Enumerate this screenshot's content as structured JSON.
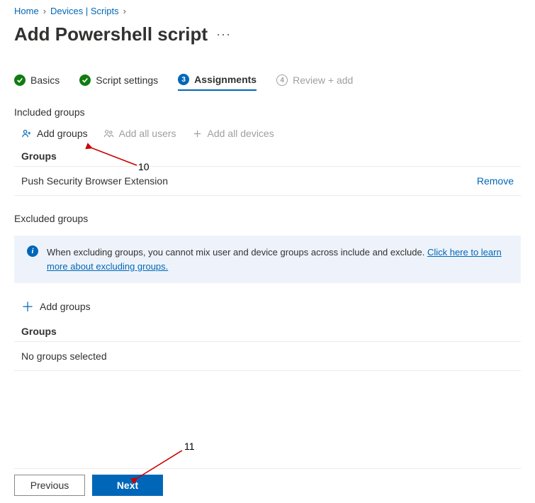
{
  "breadcrumb": {
    "items": [
      "Home",
      "Devices | Scripts"
    ]
  },
  "page_title": "Add Powershell script",
  "tabs": {
    "basics": "Basics",
    "script_settings": "Script settings",
    "assignments_num": "3",
    "assignments": "Assignments",
    "review_num": "4",
    "review": "Review + add"
  },
  "included": {
    "heading": "Included groups",
    "add_groups": "Add groups",
    "add_all_users": "Add all users",
    "add_all_devices": "Add all devices",
    "groups_label": "Groups",
    "rows": [
      {
        "name": "Push Security Browser Extension",
        "remove": "Remove"
      }
    ]
  },
  "excluded": {
    "heading": "Excluded groups",
    "info_text": "When excluding groups, you cannot mix user and device groups across include and exclude. ",
    "info_link": "Click here to learn more about excluding groups.",
    "add_groups": "Add groups",
    "groups_label": "Groups",
    "empty": "No groups selected"
  },
  "footer": {
    "previous": "Previous",
    "next": "Next"
  },
  "annotations": {
    "a10": "10",
    "a11": "11"
  }
}
